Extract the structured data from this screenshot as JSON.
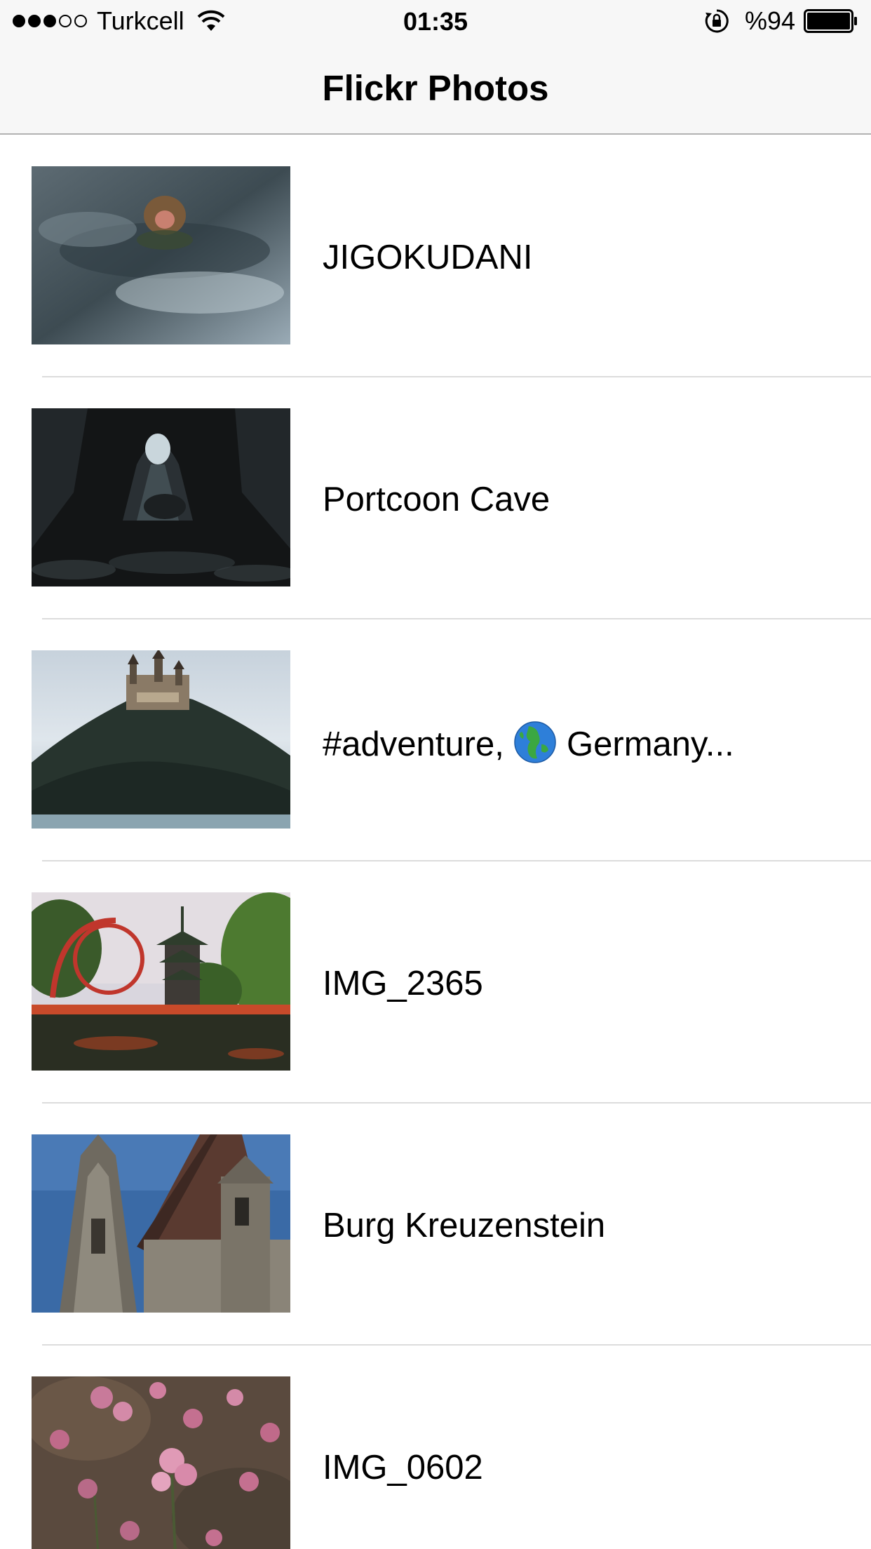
{
  "status_bar": {
    "signal_dots": [
      true,
      true,
      true,
      false,
      false
    ],
    "carrier": "Turkcell",
    "time": "01:35",
    "battery_percent": "%94",
    "icons": [
      "wifi-icon",
      "orientation-lock-icon",
      "battery-icon"
    ]
  },
  "nav": {
    "title": "Flickr Photos"
  },
  "photos": [
    {
      "title_before": "JIGOKUDANI",
      "title_after": "",
      "thumbnail": "snow-monkey-hot-spring"
    },
    {
      "title_before": "Portcoon Cave",
      "title_after": "",
      "thumbnail": "sea-cave"
    },
    {
      "title_before": "#adventure, ",
      "title_after": " Germany...",
      "has_globe_emoji": true,
      "thumbnail": "hilltop-castle"
    },
    {
      "title_before": "IMG_2365",
      "title_after": "",
      "thumbnail": "pagoda-rollercoaster"
    },
    {
      "title_before": "Burg Kreuzenstein",
      "title_after": "",
      "thumbnail": "castle-towers"
    },
    {
      "title_before": "IMG_0602",
      "title_after": "",
      "thumbnail": "pink-flowers"
    }
  ],
  "colors": {
    "bar_background": "#f7f7f7",
    "separator": "#dcdcdc",
    "text": "#000000"
  }
}
